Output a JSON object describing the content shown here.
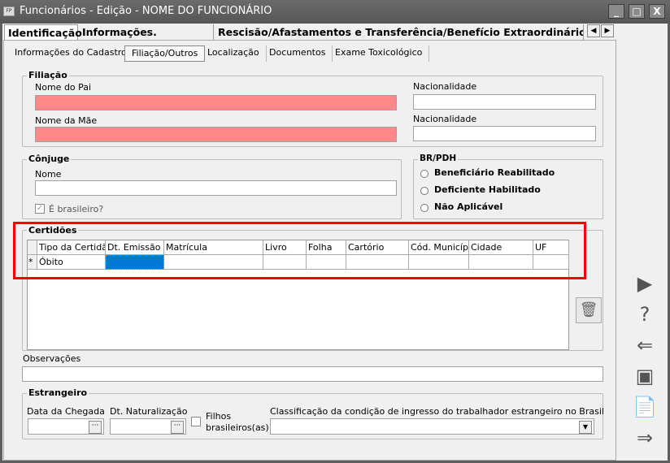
{
  "window": {
    "title": "Funcionários - Edição - NOME DO FUNCIONÁRIO",
    "app_icon": "FP"
  },
  "main_tabs": [
    {
      "label": "Identificação",
      "active": true
    },
    {
      "label": "Informações. Contratuais"
    },
    {
      "label": "Rescisão/Afastamentos e Transferência/Benefício Extraordinário Mensal"
    }
  ],
  "sub_tabs": [
    {
      "label": "Informações do Cadastro"
    },
    {
      "label": "Filiação/Outros",
      "active": true
    },
    {
      "label": "Localização"
    },
    {
      "label": "Documentos"
    },
    {
      "label": "Exame Toxicológico"
    }
  ],
  "filiacao": {
    "title": "Filiação",
    "pai_label": "Nome do Pai",
    "pai_value": "",
    "mae_label": "Nome da Mãe",
    "mae_value": "",
    "nac1_label": "Nacionalidade",
    "nac2_label": "Nacionalidade",
    "required_color": "#ff8888"
  },
  "conjuge": {
    "title": "Cônjuge",
    "nome_label": "Nome",
    "nome_value": "",
    "brasileiro_label": "É brasileiro?",
    "brasileiro_checked": true
  },
  "brpdh": {
    "title": "BR/PDH",
    "options": [
      "Beneficiário Reabilitado",
      "Deficiente Habilitado",
      "Não Aplicável"
    ]
  },
  "certidoes": {
    "title": "Certidões",
    "columns": [
      "Tipo da Certidão",
      "Dt. Emissão",
      "Matrícula",
      "Livro",
      "Folha",
      "Cartório",
      "Cód. Município",
      "Cidade",
      "UF"
    ],
    "rows": [
      {
        "indicator": "*",
        "cells": [
          "Óbito",
          "",
          "",
          "",
          "",
          "",
          "",
          "",
          ""
        ]
      }
    ],
    "selected_color": "#0078d7",
    "highlight_color": "#ff0000"
  },
  "observacoes": {
    "label": "Observações",
    "value": ""
  },
  "estrangeiro": {
    "title": "Estrangeiro",
    "chegada_label": "Data da Chegada",
    "naturalizacao_label": "Dt. Naturalização",
    "filhos_label_1": "Filhos",
    "filhos_label_2": "brasileiros(as)",
    "classificacao_label": "Classificação da condição de ingresso do trabalhador estrangeiro no Brasil"
  },
  "sidebar_icons": [
    "monitor-play-icon",
    "help-icon",
    "back-arrow-icon",
    "save-icon",
    "document-cancel-icon",
    "forward-arrow-icon"
  ]
}
